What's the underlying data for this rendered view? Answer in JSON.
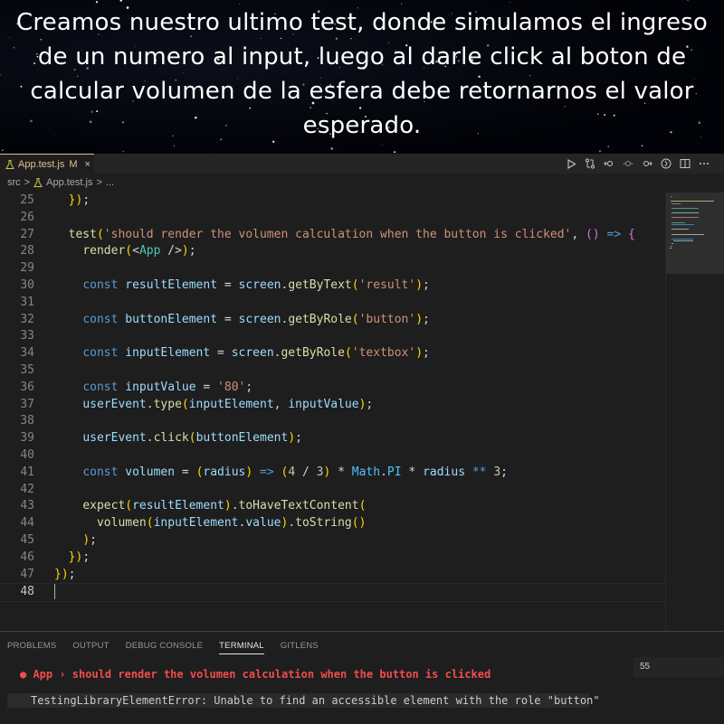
{
  "caption": "Creamos nuestro ultimo test, donde simulamos el ingreso de un numero al input, luego al darle click al boton de calcular volumen de la esfera debe retornarnos el valor esperado.",
  "tab": {
    "name": "App.test.js",
    "status": "M",
    "close": "×"
  },
  "breadcrumb": {
    "folder": "src",
    "sep1": ">",
    "file": "App.test.js",
    "sep2": ">",
    "rest": "..."
  },
  "code_lines": [
    {
      "n": "25",
      "text": "  });"
    },
    {
      "n": "26",
      "text": ""
    },
    {
      "n": "27",
      "text": "  test('should render the volumen calculation when the button is clicked', () => {"
    },
    {
      "n": "28",
      "text": "    render(<App />);"
    },
    {
      "n": "29",
      "text": ""
    },
    {
      "n": "30",
      "text": "    const resultElement = screen.getByText('result');"
    },
    {
      "n": "31",
      "text": ""
    },
    {
      "n": "32",
      "text": "    const buttonElement = screen.getByRole('button');"
    },
    {
      "n": "33",
      "text": ""
    },
    {
      "n": "34",
      "text": "    const inputElement = screen.getByRole('textbox');"
    },
    {
      "n": "35",
      "text": ""
    },
    {
      "n": "36",
      "text": "    const inputValue = '80';"
    },
    {
      "n": "37",
      "text": "    userEvent.type(inputElement, inputValue);"
    },
    {
      "n": "38",
      "text": ""
    },
    {
      "n": "39",
      "text": "    userEvent.click(buttonElement);"
    },
    {
      "n": "40",
      "text": ""
    },
    {
      "n": "41",
      "text": "    const volumen = (radius) => (4 / 3) * Math.PI * radius ** 3;"
    },
    {
      "n": "42",
      "text": ""
    },
    {
      "n": "43",
      "text": "    expect(resultElement).toHaveTextContent("
    },
    {
      "n": "44",
      "text": "      volumen(inputElement.value).toString()"
    },
    {
      "n": "45",
      "text": "    );"
    },
    {
      "n": "46",
      "text": "  });"
    },
    {
      "n": "47",
      "text": "});"
    },
    {
      "n": "48",
      "text": ""
    }
  ],
  "panel": {
    "tabs": [
      "PROBLEMS",
      "OUTPUT",
      "DEBUG CONSOLE",
      "TERMINAL",
      "GITLENS"
    ],
    "active_tab": "TERMINAL",
    "terminal_line1": "● App › should render the volumen calculation when the button is clicked",
    "terminal_line2": "TestingLibraryElementError: Unable to find an accessible element with the role \"button\"",
    "terminal_instance": "55"
  },
  "colors": {
    "keyword": "#569cd6",
    "function": "#dcdcaa",
    "string": "#ce9178",
    "variable": "#9cdcfe",
    "number": "#b5cea8",
    "error": "#f14c4c",
    "modified": "#e2c08d"
  },
  "icons": [
    "flask-icon",
    "close-icon",
    "run-icon",
    "compare-icon",
    "go-back-icon",
    "circle-icon",
    "go-forward-icon",
    "gitlens-icon",
    "split-editor-icon",
    "more-actions-icon"
  ]
}
